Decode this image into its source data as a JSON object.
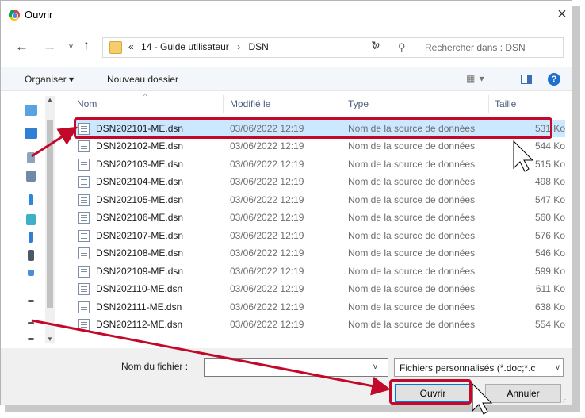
{
  "window": {
    "title": "Ouvrir",
    "close": "×"
  },
  "nav": {
    "back": "←",
    "forward": "→",
    "recent": "v",
    "up": "↑",
    "breadcrumb": [
      "«",
      "14 - Guide utilisateur",
      "›",
      "DSN"
    ],
    "address_dropdown": "v",
    "refresh": "↻"
  },
  "search": {
    "placeholder": "Rechercher dans : DSN"
  },
  "toolbar": {
    "organize": "Organiser ▾",
    "new_folder": "Nouveau dossier",
    "view": "▦ ▾",
    "help": "?"
  },
  "columns": {
    "name": "Nom",
    "modified": "Modifié le",
    "type": "Type",
    "size": "Taille"
  },
  "files": [
    {
      "name": "DSN202101-ME.dsn",
      "modified": "03/06/2022 12:19",
      "type": "Nom de la source de données",
      "size": "531 Ko"
    },
    {
      "name": "DSN202102-ME.dsn",
      "modified": "03/06/2022 12:19",
      "type": "Nom de la source de données",
      "size": "544 Ko"
    },
    {
      "name": "DSN202103-ME.dsn",
      "modified": "03/06/2022 12:19",
      "type": "Nom de la source de données",
      "size": "515 Ko"
    },
    {
      "name": "DSN202104-ME.dsn",
      "modified": "03/06/2022 12:19",
      "type": "Nom de la source de données",
      "size": "498 Ko"
    },
    {
      "name": "DSN202105-ME.dsn",
      "modified": "03/06/2022 12:19",
      "type": "Nom de la source de données",
      "size": "547 Ko"
    },
    {
      "name": "DSN202106-ME.dsn",
      "modified": "03/06/2022 12:19",
      "type": "Nom de la source de données",
      "size": "560 Ko"
    },
    {
      "name": "DSN202107-ME.dsn",
      "modified": "03/06/2022 12:19",
      "type": "Nom de la source de données",
      "size": "576 Ko"
    },
    {
      "name": "DSN202108-ME.dsn",
      "modified": "03/06/2022 12:19",
      "type": "Nom de la source de données",
      "size": "546 Ko"
    },
    {
      "name": "DSN202109-ME.dsn",
      "modified": "03/06/2022 12:19",
      "type": "Nom de la source de données",
      "size": "599 Ko"
    },
    {
      "name": "DSN202110-ME.dsn",
      "modified": "03/06/2022 12:19",
      "type": "Nom de la source de données",
      "size": "611 Ko"
    },
    {
      "name": "DSN202111-ME.dsn",
      "modified": "03/06/2022 12:19",
      "type": "Nom de la source de données",
      "size": "638 Ko"
    },
    {
      "name": "DSN202112-ME.dsn",
      "modified": "03/06/2022 12:19",
      "type": "Nom de la source de données",
      "size": "554 Ko"
    }
  ],
  "bottom": {
    "filename_label": "Nom du fichier :",
    "filename_value": "",
    "filter": "Fichiers personnalisés (*.doc;*.c",
    "dropdown": "v",
    "open": "Ouvrir",
    "cancel": "Annuler"
  },
  "colors": {
    "annotation": "#c3092a",
    "accent": "#0078d7"
  }
}
